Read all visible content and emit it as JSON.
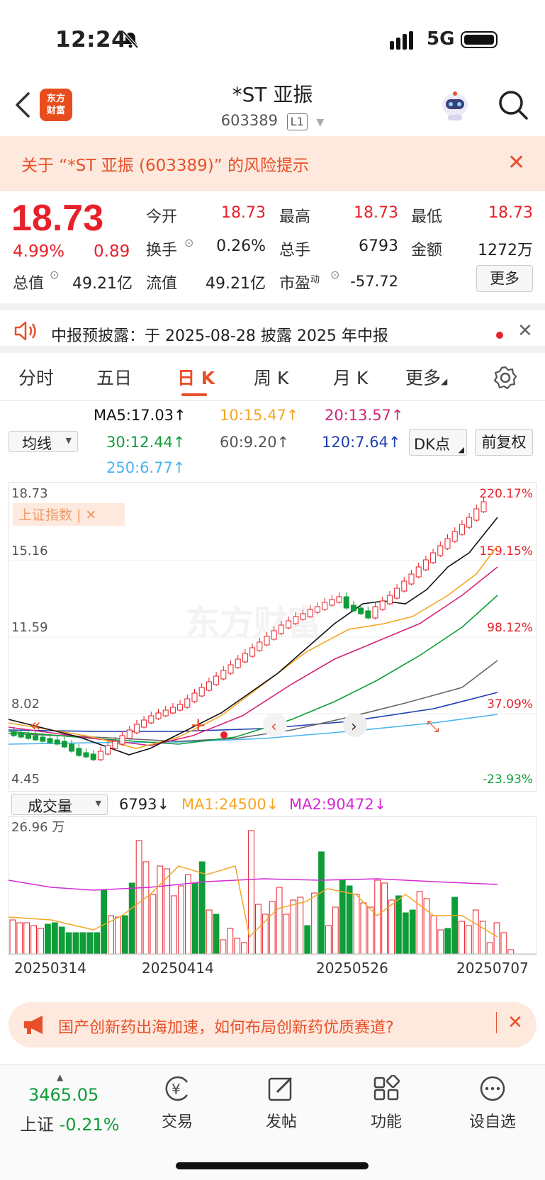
{
  "status_bar": {
    "time": "12:24",
    "network": "5G"
  },
  "header": {
    "app_logo_text": "东方\n财富",
    "title": "*ST 亚振",
    "code": "603389",
    "level": "L1"
  },
  "risk_banner": {
    "text": "关于 “*ST 亚振 (603389)” 的风险提示"
  },
  "quote": {
    "price": "18.73",
    "change_pct": "4.99%",
    "change_abs": "0.89",
    "rows": [
      [
        {
          "label": "今开",
          "value": "18.73",
          "color": "red"
        },
        {
          "label": "最高",
          "value": "18.73",
          "color": "red"
        },
        {
          "label": "最低",
          "value": "18.73",
          "color": "red"
        }
      ],
      [
        {
          "label": "换手",
          "value": "0.26%",
          "color": "black"
        },
        {
          "label": "总手",
          "value": "6793",
          "color": "black"
        },
        {
          "label": "金额",
          "value": "1272万",
          "color": "black"
        }
      ],
      [
        {
          "label": "流值",
          "value": "49.21亿",
          "color": "black"
        },
        {
          "label": "市盈",
          "sup": "动",
          "value": "-57.72",
          "color": "black"
        }
      ]
    ],
    "total_value_label": "总值",
    "total_value": "49.21亿",
    "more_label": "更多"
  },
  "notice": {
    "text": "中报预披露：于 2025-08-28 披露 2025 年中报"
  },
  "tabs": [
    "分时",
    "五日",
    "日 K",
    "周 K",
    "月 K",
    "更多"
  ],
  "active_tab": 2,
  "ma_legend": {
    "type_label": "均线",
    "items": [
      {
        "text": "MA5:17.03↑",
        "color": "#111111"
      },
      {
        "text": "10:15.47↑",
        "color": "#f5a623"
      },
      {
        "text": "20:13.57↑",
        "color": "#d4237a"
      },
      {
        "text": "30:12.44↑",
        "color": "#0e9d38"
      },
      {
        "text": "60:9.20↑",
        "color": "#555555"
      },
      {
        "text": "120:7.64↑",
        "color": "#1e3fb0"
      },
      {
        "text": "250:6.77↑",
        "color": "#4ab3f0"
      }
    ],
    "dk_label": "DK点",
    "adjust_label": "前复权"
  },
  "kline": {
    "y_labels": [
      "18.73",
      "15.16",
      "11.59",
      "8.02",
      "4.45"
    ],
    "pct_labels": [
      {
        "text": "220.17%",
        "color": "#e8202a"
      },
      {
        "text": "159.15%",
        "color": "#e8202a"
      },
      {
        "text": "98.12%",
        "color": "#e8202a"
      },
      {
        "text": "37.09%",
        "color": "#e8202a"
      },
      {
        "text": "-23.93%",
        "color": "#0e9d38"
      }
    ],
    "overlay_label": "上证指数 | ✕",
    "watermark": "东方财富"
  },
  "volume": {
    "type_label": "成交量",
    "current": "6793↓",
    "ma1": "MA1:24500↓",
    "ma2": "MA2:90472↓",
    "y_label": "26.96 万",
    "dates": [
      "20250314",
      "20250414",
      "20250526",
      "20250707"
    ]
  },
  "promo": {
    "text": "国产创新药出海加速，如何布局创新药优质赛道?"
  },
  "bottom_bar": {
    "index_value": "3465.05",
    "index_label": "上证",
    "index_change": "-0.21%",
    "items": [
      "交易",
      "发帖",
      "功能",
      "设自选"
    ]
  },
  "colors": {
    "up": "#e8202a",
    "down": "#0e9d38",
    "accent": "#e8502a"
  }
}
